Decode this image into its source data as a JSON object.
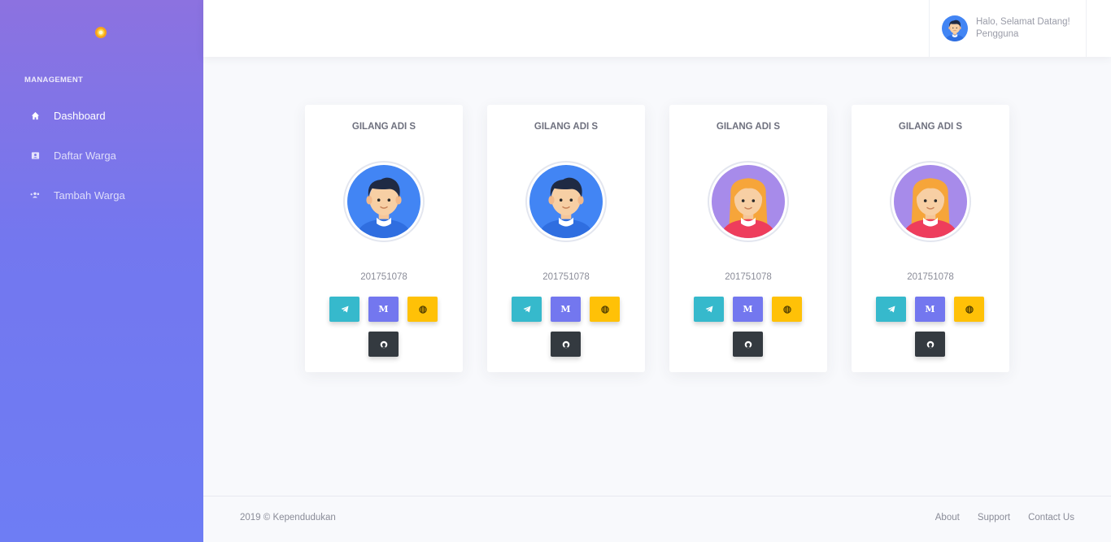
{
  "sidebar": {
    "section_heading": "MANAGEMENT",
    "items": [
      {
        "label": "Dashboard",
        "icon": "home-icon",
        "active": true
      },
      {
        "label": "Daftar Warga",
        "icon": "id-card-icon"
      },
      {
        "label": "Tambah Warga",
        "icon": "users-plus-icon"
      }
    ]
  },
  "topbar": {
    "greeting": "Halo, Selamat Datang!",
    "user_name": "Pengguna"
  },
  "cards": [
    {
      "name": "GILANG ADI S",
      "id": "201751078",
      "avatar": "male-avatar"
    },
    {
      "name": "GILANG ADI S",
      "id": "201751078",
      "avatar": "male-avatar"
    },
    {
      "name": "GILANG ADI S",
      "id": "201751078",
      "avatar": "female-avatar"
    },
    {
      "name": "GILANG ADI S",
      "id": "201751078",
      "avatar": "female-avatar"
    }
  ],
  "social_buttons": {
    "medium_label": "M",
    "icons": [
      "telegram-icon",
      "medium-icon",
      "globe-icon",
      "github-icon"
    ]
  },
  "footer": {
    "copyright": "2019 © Kependudukan",
    "links": [
      "About",
      "Support",
      "Contact Us"
    ]
  },
  "colors": {
    "sidebar_top": "#8c72e0",
    "sidebar_bottom": "#6e7df4",
    "telegram": "#36b9cc",
    "medium": "#7377ef",
    "web": "#ffc107",
    "github": "#343a40",
    "male_avatar_bg": "#4285f4",
    "female_avatar_bg": "#a78bea"
  }
}
